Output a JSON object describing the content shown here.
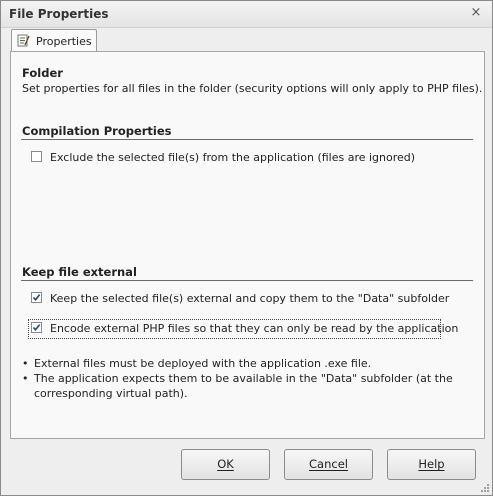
{
  "window": {
    "title": "File Properties",
    "close_glyph": "×"
  },
  "tabs": [
    {
      "label": "Properties",
      "icon": "properties-sheet-icon",
      "selected": true
    }
  ],
  "folder_section": {
    "heading": "Folder",
    "description": "Set properties for all files in the folder (security options will only apply to PHP files)."
  },
  "compilation_section": {
    "heading": "Compilation Properties",
    "exclude_checkbox": {
      "label": "Exclude the selected file(s) from the application (files are ignored)",
      "checked": false
    }
  },
  "external_section": {
    "heading": "Keep file external",
    "keep_external_checkbox": {
      "label": "Keep the selected file(s) external and copy them to the \"Data\" subfolder",
      "checked": true
    },
    "encode_checkbox": {
      "label": "Encode external PHP files so that they can only be read by the application",
      "checked": true
    }
  },
  "notes": [
    "External files must be deployed with the application .exe file.",
    "The application expects them to be available in the \"Data\" subfolder (at the corresponding virtual path)."
  ],
  "buttons": {
    "ok": "OK",
    "cancel": "Cancel",
    "help": "Help"
  }
}
